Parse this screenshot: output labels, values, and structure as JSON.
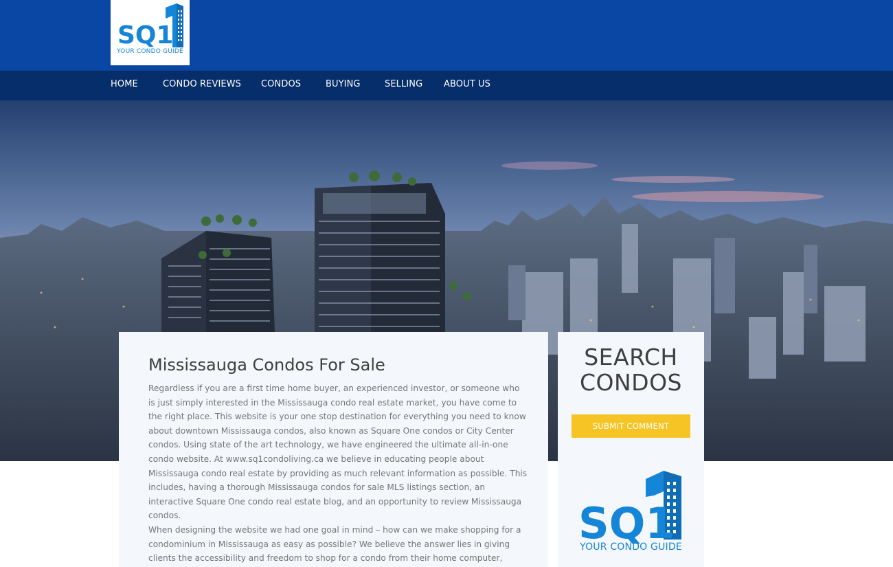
{
  "brand": {
    "logo_text": "SQ1",
    "tagline": "YOUR CONDO GUIDE",
    "primary_color": "#0a47a4",
    "nav_color": "#062e6a",
    "logo_blue": "#1585d8",
    "accent_color": "#f6c525"
  },
  "nav": {
    "items": [
      {
        "label": "HOME"
      },
      {
        "label": "CONDO REVIEWS"
      },
      {
        "label": "CONDOS"
      },
      {
        "label": "BUYING"
      },
      {
        "label": "SELLING"
      },
      {
        "label": "ABOUT US"
      }
    ]
  },
  "main": {
    "title": "Mississauga Condos For Sale",
    "paragraphs": [
      "Regardless if you are a first time home buyer, an experienced investor, or someone who is just simply interested in the Mississauga condo real estate market, you have come to the right place. This website is your one stop destination for everything you need to know about downtown Mississauga condos, also known as Square One condos or City Center condos. Using state of the art technology, we have engineered the ultimate all-in-one condo website. At www.sq1condoliving.ca we believe in educating people about Mississauga condo real estate by providing as much relevant information as possible. This includes, having a thorough Mississauga condos for sale MLS listings section, an interactive Square One condo real estate blog, and an opportunity to review Mississauga condos.",
      "When designing the website we had one goal in mind – how can we make shopping for a condominium in Mississauga as easy as possible? We believe the answer lies in giving clients the accessibility and freedom to shop for a condo from their home computer, without the immediate need of a real estate agent. Once the person is familiarized with Square One"
    ]
  },
  "sidebar": {
    "title_line1": "SEARCH",
    "title_line2": "CONDOS",
    "submit_label": "SUBMIT COMMENT",
    "logo_tagline": "YOUR CONDO GUIDE"
  },
  "hero": {
    "image": "city-skyline-condo-towers"
  }
}
